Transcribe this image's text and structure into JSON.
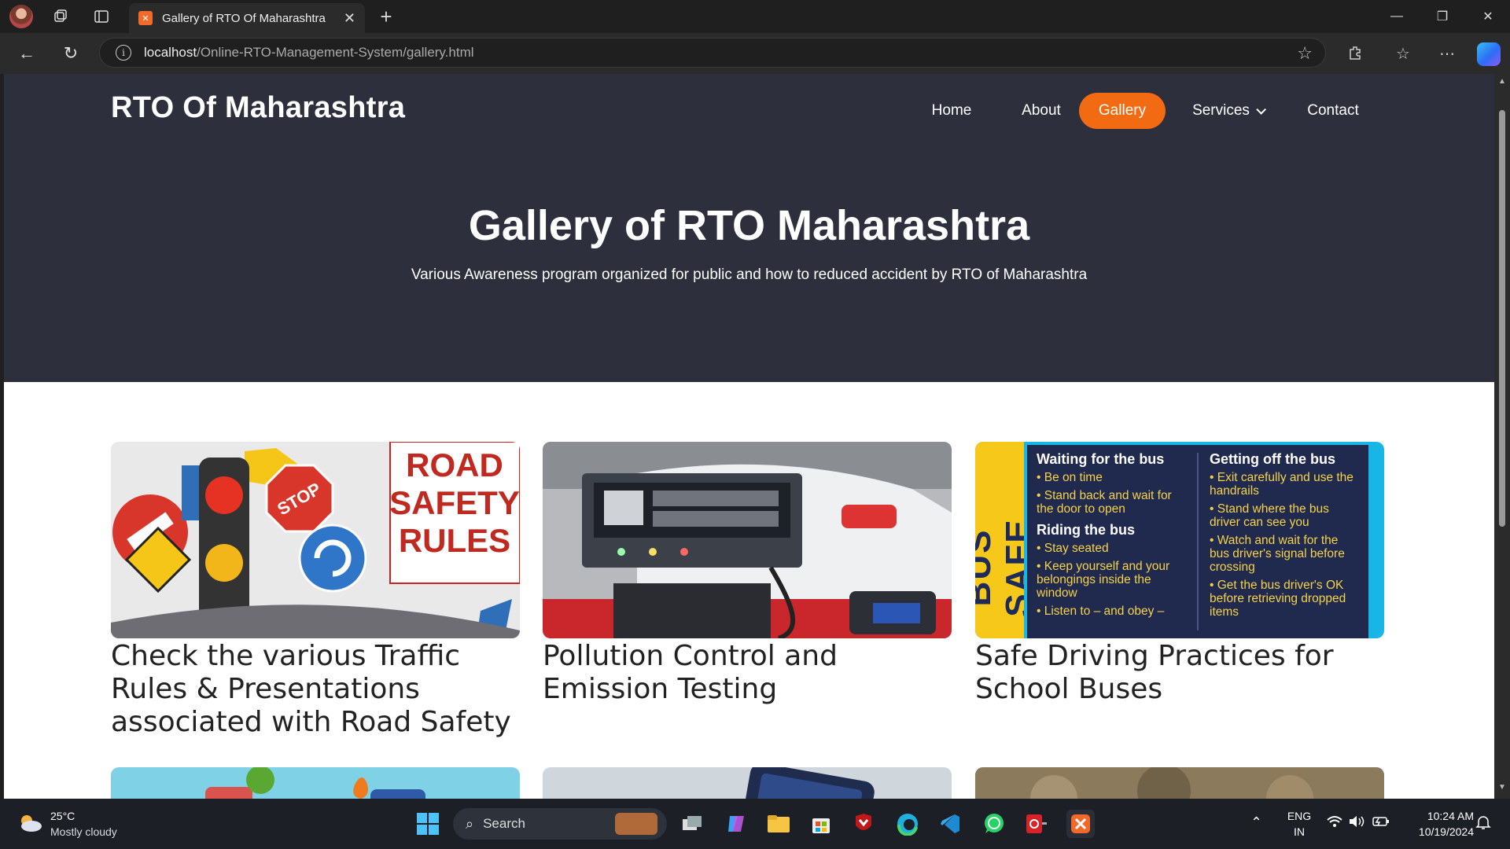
{
  "browser": {
    "tab_title": "Gallery of RTO Of Maharashtra",
    "tab_favicon": "xampp-icon",
    "new_tab": "+",
    "url_host": "localhost",
    "url_path": "/Online-RTO-Management-System/gallery.html"
  },
  "site": {
    "logo": "RTO Of Maharashtra",
    "nav": {
      "home": "Home",
      "about": "About",
      "gallery": "Gallery",
      "services": "Services",
      "contact": "Contact"
    },
    "hero_title": "Gallery of RTO Maharashtra",
    "hero_subtitle": "Various Awareness program organized for public and how to reduced accident by RTO of Maharashtra",
    "cards": [
      {
        "caption": "Check the various Traffic Rules & Presentations associated with Road Safety",
        "image_text": "ROAD SAFETY RULES",
        "sign_text": "STOP"
      },
      {
        "caption": "Pollution Control and Emission Testing"
      },
      {
        "caption": "Safe Driving Practices for School Buses",
        "poster": {
          "side_text": "BUS SAFE",
          "col1_h1": "Waiting for the bus",
          "col1_b1": "Be on time",
          "col1_b2": "Stand back and wait for the door to open",
          "col1_h2": "Riding the bus",
          "col1_b3": "Stay seated",
          "col1_b4": "Keep yourself and your belongings inside the window",
          "col1_b5": "Listen to – and obey –",
          "col2_h1": "Getting off the bus",
          "col2_b1": "Exit carefully and use the handrails",
          "col2_b2": "Stand where the bus driver can see you",
          "col2_b3": "Watch and wait for the bus driver's signal before crossing",
          "col2_b4": "Get the bus driver's OK before retrieving dropped items"
        }
      }
    ]
  },
  "taskbar": {
    "temperature": "25°C",
    "weather": "Mostly cloudy",
    "search_placeholder": "Search",
    "lang_top": "ENG",
    "lang_bottom": "IN",
    "time": "10:24 AM",
    "date": "10/19/2024"
  },
  "colors": {
    "hero_bg": "#2d2f3d",
    "accent": "#f26a12"
  }
}
